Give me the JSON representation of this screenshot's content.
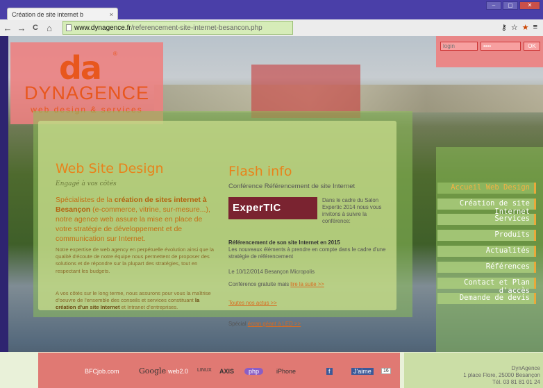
{
  "browser": {
    "tab_title": "Création de site internet b",
    "tab_close": "×",
    "url_domain": "www.dynagence.fr",
    "url_path": "/referencement-site-internet-besancon.php",
    "nav_back": "←",
    "nav_forward": "→",
    "nav_reload": "C",
    "nav_home": "⌂",
    "win_min": "–",
    "win_max": "▢",
    "win_close": "✕",
    "tool_key": "⚷",
    "tool_star": "☆",
    "tool_star_fav": "★",
    "tool_menu": "≡"
  },
  "header": {
    "logo_mark": "da",
    "logo_reg": "®",
    "logo_name": "DYNAGENCE",
    "logo_tagline": "web design & services",
    "login_placeholder": "login",
    "password_value": "••••",
    "ok_label": "OK"
  },
  "left": {
    "title": "Web Site Design",
    "script": "Engagé à vos côtés",
    "lead_1": "Spécialistes de la ",
    "lead_bold": "création de sites internet à Besançon",
    "lead_2": " (e-commerce, vitrine, sur-mesure...), notre agence web assure la mise en place de votre stratégie de développement et de communication sur Internet.",
    "p1": "Notre expertise de web agency en perpétuelle évolution ainsi que la qualité d'écoute de notre équipe nous permettent de proposer des solutions et de répondre sur la plupart des stratégies, tout en respectant les budgets.",
    "p2_a": "A vos côtés sur le long terme, nous assurons pour vous la maîtrise d'oeuvre de l'ensemble des conseils et services constituant ",
    "p2_bold": "la création d'un site Internet",
    "p2_b": " et Intranet d'entreprises."
  },
  "flash": {
    "title": "Flash info",
    "subtitle": "Conférence Référencement de site Internet",
    "logo_text": "ExperTIC",
    "intro": "Dans le cadre du Salon Expertic 2014 nous vous invitons à suivre la conférence:",
    "bold_title": "Référencement de son site Internet en 2015",
    "desc": "Les nouveaux éléments à prendre en compte dans le cadre d'une stratégie de référencement",
    "date": "Le 10/12/2014 Besançon Micropolis",
    "free_text": "Conférence gratuite mais ",
    "read_more": "lire la suite >>",
    "all_news": "Toutes nos actus >>",
    "special_text": "Spécial ",
    "special_link": "écran géant à LED >>"
  },
  "menu": {
    "items": [
      "Accueil Web Design",
      "Création de site Internet",
      "Services",
      "Produits",
      "Actualités",
      "Références",
      "Contact et Plan d'accès",
      "Demande de devis"
    ]
  },
  "footer": {
    "partners": [
      "BFCjob.com",
      "Google",
      "web2.0",
      "LINUX",
      "AXIS",
      "php",
      "iPhone",
      "f",
      "J'aime",
      "16"
    ],
    "company": "DynAgence",
    "address": "1 place Flore, 25000 Besançon",
    "phone": "Tél. 03 81 81 01 24"
  },
  "colors": {
    "accent": "#e8821a",
    "highlight_red": "#ee8080",
    "highlight_green": "#8cbe5a"
  }
}
